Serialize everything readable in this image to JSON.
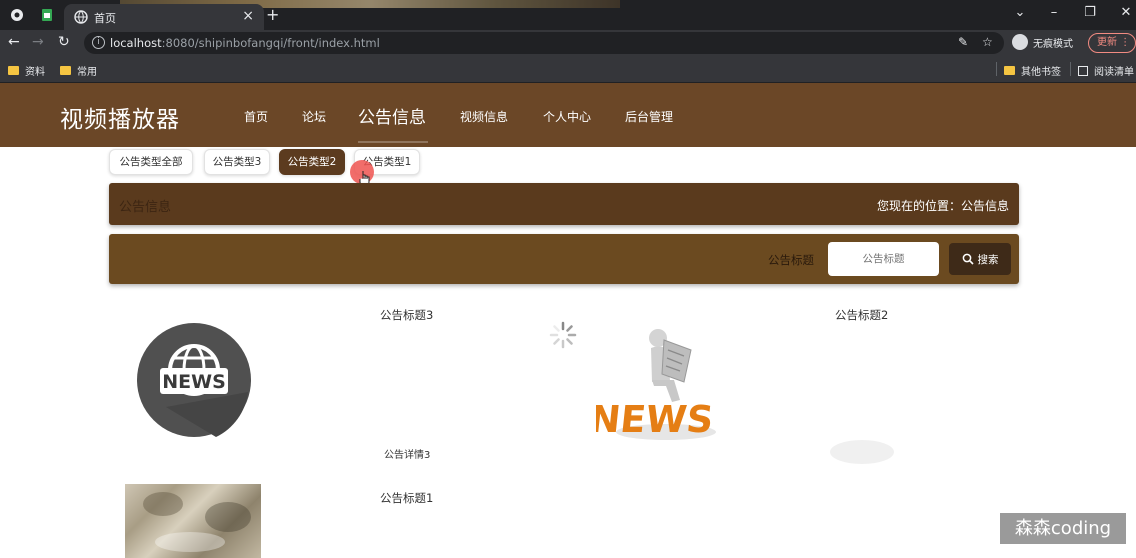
{
  "browser": {
    "tab_title": "首页",
    "url_host": "localhost",
    "url_rest": ":8080/shipinbofangqi/front/index.html",
    "profile_label": "无痕模式",
    "update_label": "更新",
    "bookmarks": [
      "资料",
      "常用"
    ],
    "bookmarks_right": [
      "其他书签",
      "阅读清单"
    ]
  },
  "site": {
    "logo": "视频播放器",
    "nav": [
      {
        "label": "首页",
        "active": false
      },
      {
        "label": "论坛",
        "active": false
      },
      {
        "label": "公告信息",
        "active": true
      },
      {
        "label": "视频信息",
        "active": false
      },
      {
        "label": "个人中心",
        "active": false
      },
      {
        "label": "后台管理",
        "active": false
      }
    ]
  },
  "filters": [
    {
      "label": "公告类型全部",
      "active": false
    },
    {
      "label": "公告类型3",
      "active": false
    },
    {
      "label": "公告类型2",
      "active": true
    },
    {
      "label": "公告类型1",
      "active": false
    }
  ],
  "breadcrumb": {
    "title": "公告信息",
    "location": "您现在的位置：公告信息"
  },
  "search": {
    "label": "公告标题",
    "placeholder": "公告标题",
    "button": "搜索"
  },
  "items": [
    {
      "title": "公告标题3",
      "detail": "公告详情3",
      "image": "news-globe-icon"
    },
    {
      "title": "公告标题2",
      "detail": "",
      "image": "news-3d-figure"
    },
    {
      "title": "公告标题1",
      "detail": "",
      "image": "newspaper-photo"
    }
  ],
  "watermark": "森森coding",
  "colors": {
    "header_bg": "#6b4727",
    "active_pill": "#5c3b1f",
    "crumb_bg": "#5a3a1d",
    "search_bg": "#6b4a20",
    "search_button": "#3e2a18"
  }
}
